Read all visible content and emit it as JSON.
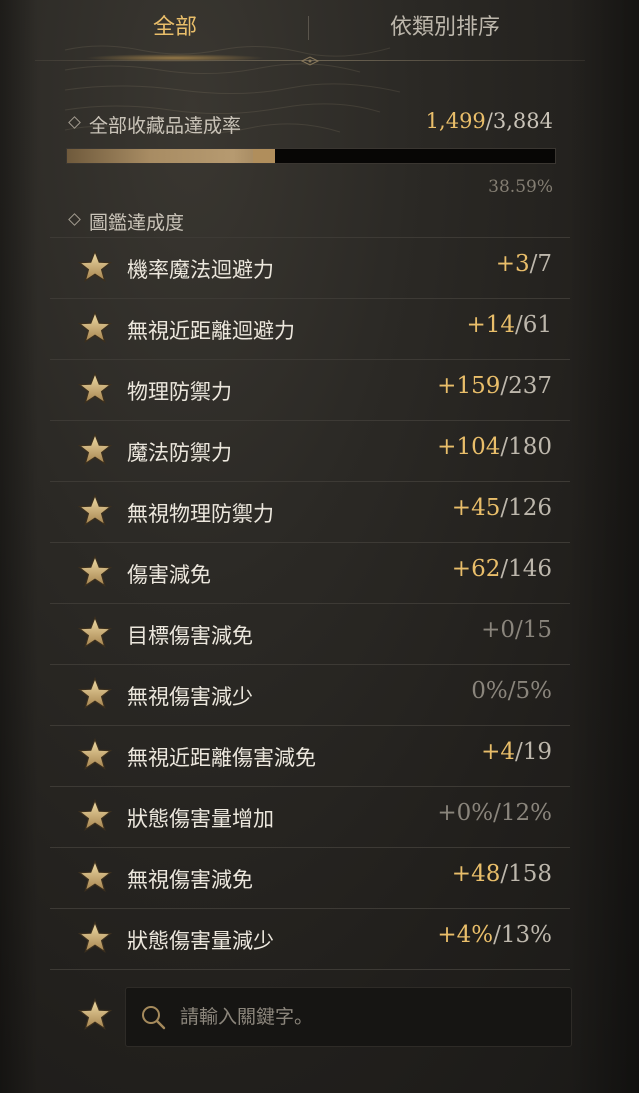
{
  "tabs": {
    "all": "全部",
    "sort_by_category": "依類別排序"
  },
  "collection": {
    "title": "全部收藏品達成率",
    "current": "1,499",
    "separator": "/",
    "total": "3,884",
    "percent": "38.59%",
    "progress_fraction": 0.4268
  },
  "codex": {
    "title": "圖鑑達成度"
  },
  "stats": [
    {
      "name": "機率魔法迴避力",
      "current": "+3",
      "max": "/7",
      "dim": false
    },
    {
      "name": "無視近距離迴避力",
      "current": "+14",
      "max": "/61",
      "dim": false
    },
    {
      "name": "物理防禦力",
      "current": "+159",
      "max": "/237",
      "dim": false
    },
    {
      "name": "魔法防禦力",
      "current": "+104",
      "max": "/180",
      "dim": false
    },
    {
      "name": "無視物理防禦力",
      "current": "+45",
      "max": "/126",
      "dim": false
    },
    {
      "name": "傷害減免",
      "current": "+62",
      "max": "/146",
      "dim": false
    },
    {
      "name": "目標傷害減免",
      "current": "+0",
      "max": "/15",
      "dim": true
    },
    {
      "name": "無視傷害減少",
      "current": "0%",
      "max": "/5%",
      "dim": true
    },
    {
      "name": "無視近距離傷害減免",
      "current": "+4",
      "max": "/19",
      "dim": false
    },
    {
      "name": "狀態傷害量增加",
      "current": "+0%",
      "max": "/12%",
      "dim": true
    },
    {
      "name": "無視傷害減免",
      "current": "+48",
      "max": "/158",
      "dim": false
    },
    {
      "name": "狀態傷害量減少",
      "current": "+4%",
      "max": "/13%",
      "dim": false
    }
  ],
  "search": {
    "placeholder": "請輸入關鍵字。"
  },
  "colors": {
    "accent_gold": "#e9be6a",
    "text": "#ece7dd",
    "muted": "#8a857c",
    "background": "#2b2925"
  },
  "icons": {
    "stat": "star-icon",
    "search": "search-icon",
    "section": "diamond-icon"
  }
}
